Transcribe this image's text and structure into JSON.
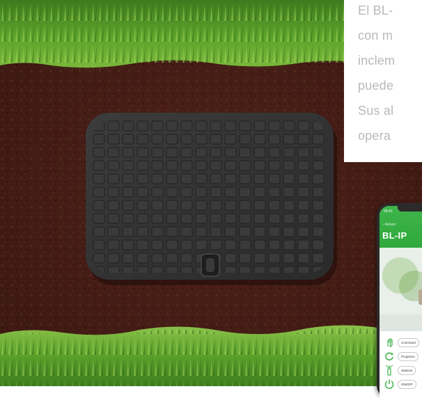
{
  "description": {
    "lines": [
      "El BL-",
      "con m",
      "inclem",
      "puede",
      "Sus al",
      "opera"
    ]
  },
  "phone": {
    "status_time": "09:41",
    "back_label": "‹ Return",
    "app_title": "BL-IP",
    "menu": [
      {
        "label": "Command",
        "icon": "hand-icon"
      },
      {
        "label": "Programs",
        "icon": "refresh-icon"
      },
      {
        "label": "Stations",
        "icon": "sprinkler-icon"
      },
      {
        "label": "ON/OFF",
        "icon": "power-icon"
      }
    ]
  },
  "colors": {
    "accent_green": "#3fb54a",
    "text_grey": "#b9b9b9"
  }
}
